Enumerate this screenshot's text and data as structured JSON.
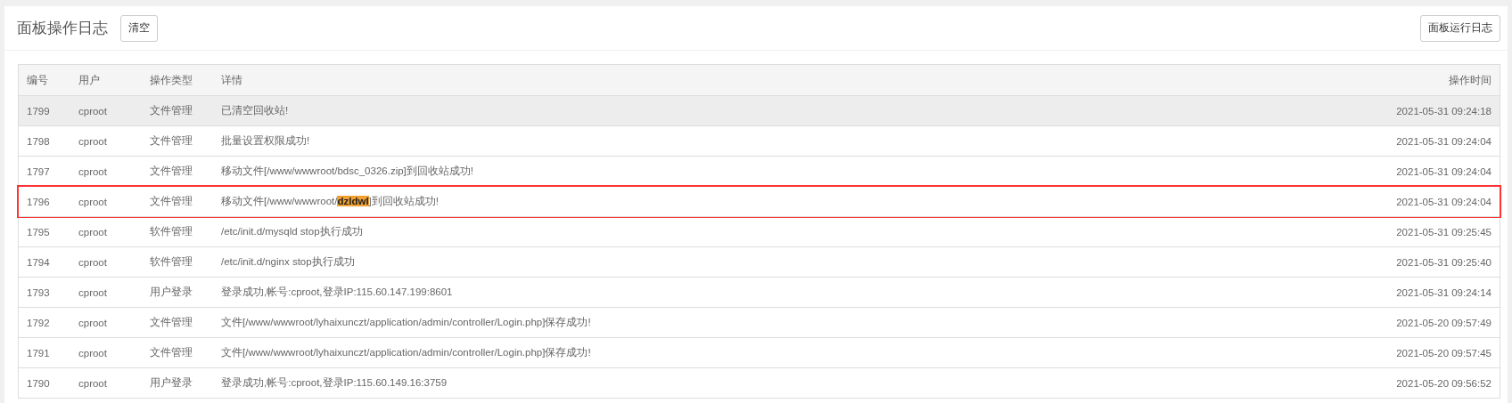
{
  "header": {
    "title": "面板操作日志",
    "clear_button": "清空",
    "run_log_button": "面板运行日志"
  },
  "table": {
    "columns": [
      "编号",
      "用户",
      "操作类型",
      "详情",
      "操作时间"
    ],
    "rows": [
      {
        "id": "1799",
        "user": "cproot",
        "type": "文件管理",
        "detail": [
          {
            "text": "已清空回收站!",
            "marked": false
          }
        ],
        "time": "2021-05-31 09:24:18",
        "hovered": true,
        "outlined": false
      },
      {
        "id": "1798",
        "user": "cproot",
        "type": "文件管理",
        "detail": [
          {
            "text": "批量设置权限成功!",
            "marked": false
          }
        ],
        "time": "2021-05-31 09:24:04",
        "hovered": false,
        "outlined": false
      },
      {
        "id": "1797",
        "user": "cproot",
        "type": "文件管理",
        "detail": [
          {
            "text": "移动文件[/www/wwwroot/bdsc_0326.zip]到回收站成功!",
            "marked": false
          }
        ],
        "time": "2021-05-31 09:24:04",
        "hovered": false,
        "outlined": false
      },
      {
        "id": "1796",
        "user": "cproot",
        "type": "文件管理",
        "detail": [
          {
            "text": "移动文件[/www/wwwroot/",
            "marked": false
          },
          {
            "text": "dzldwl",
            "marked": true
          },
          {
            "text": "]到回收站成功!",
            "marked": false
          }
        ],
        "time": "2021-05-31 09:24:04",
        "hovered": false,
        "outlined": true
      },
      {
        "id": "1795",
        "user": "cproot",
        "type": "软件管理",
        "detail": [
          {
            "text": "/etc/init.d/mysqld stop执行成功",
            "marked": false
          }
        ],
        "time": "2021-05-31 09:25:45",
        "hovered": false,
        "outlined": false
      },
      {
        "id": "1794",
        "user": "cproot",
        "type": "软件管理",
        "detail": [
          {
            "text": "/etc/init.d/nginx stop执行成功",
            "marked": false
          }
        ],
        "time": "2021-05-31 09:25:40",
        "hovered": false,
        "outlined": false
      },
      {
        "id": "1793",
        "user": "cproot",
        "type": "用户登录",
        "detail": [
          {
            "text": "登录成功,帐号:cproot,登录IP:115.60.147.199:8601",
            "marked": false
          }
        ],
        "time": "2021-05-31 09:24:14",
        "hovered": false,
        "outlined": false
      },
      {
        "id": "1792",
        "user": "cproot",
        "type": "文件管理",
        "detail": [
          {
            "text": "文件[/www/wwwroot/lyhaixunczt/application/admin/controller/Login.php]保存成功!",
            "marked": false
          }
        ],
        "time": "2021-05-20 09:57:49",
        "hovered": false,
        "outlined": false
      },
      {
        "id": "1791",
        "user": "cproot",
        "type": "文件管理",
        "detail": [
          {
            "text": "文件[/www/wwwroot/lyhaixunczt/application/admin/controller/Login.php]保存成功!",
            "marked": false
          }
        ],
        "time": "2021-05-20 09:57:45",
        "hovered": false,
        "outlined": false
      },
      {
        "id": "1790",
        "user": "cproot",
        "type": "用户登录",
        "detail": [
          {
            "text": "登录成功,帐号:cproot,登录IP:115.60.149.16:3759",
            "marked": false
          }
        ],
        "time": "2021-05-20 09:56:52",
        "hovered": false,
        "outlined": false
      }
    ]
  }
}
